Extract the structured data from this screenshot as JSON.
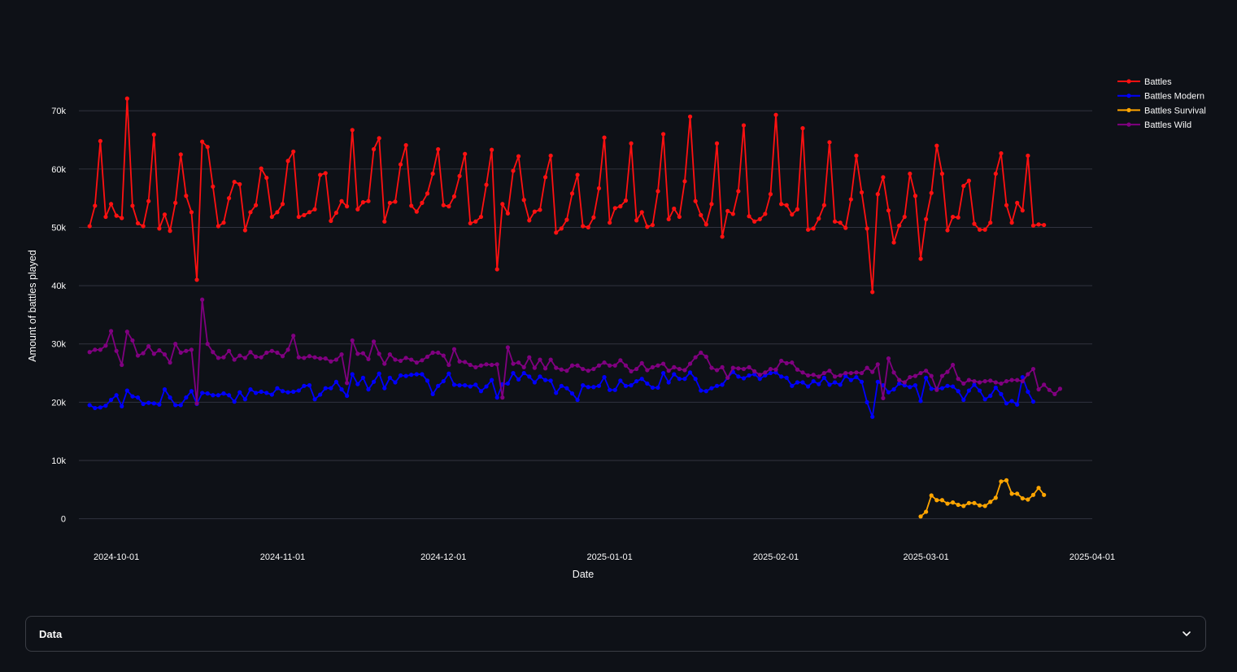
{
  "chart_data": {
    "type": "line",
    "xlabel": "Date",
    "ylabel": "Amount of battles played",
    "xlim": [
      "2024-09-24",
      "2025-04-01"
    ],
    "ylim": [
      -2000,
      77000
    ],
    "y_ticks": [
      0,
      10000,
      20000,
      30000,
      40000,
      50000,
      60000,
      70000
    ],
    "y_tick_labels": [
      "0",
      "10k",
      "20k",
      "30k",
      "40k",
      "50k",
      "60k",
      "70k"
    ],
    "x_ticks": [
      "2024-10-01",
      "2024-11-01",
      "2024-12-01",
      "2025-01-01",
      "2025-02-01",
      "2025-03-01",
      "2025-04-01"
    ],
    "grid": true,
    "legend": "top-right",
    "start_date": "2024-09-26",
    "series": [
      {
        "name": "Battles",
        "color": "#ff1111",
        "start": "2024-09-26",
        "values": [
          50200,
          53700,
          64800,
          51800,
          54000,
          52000,
          51600,
          72100,
          53700,
          50700,
          50200,
          54500,
          65900,
          49800,
          52200,
          49400,
          54200,
          62500,
          55400,
          52600,
          41000,
          64700,
          63800,
          57000,
          50200,
          50800,
          55000,
          57800,
          57400,
          49500,
          52600,
          53800,
          60100,
          58500,
          51800,
          52600,
          54000,
          61400,
          63000,
          51800,
          52100,
          52600,
          53100,
          59000,
          59300,
          51100,
          52500,
          54500,
          53600,
          66700,
          53100,
          54300,
          54500,
          63400,
          65300,
          51000,
          54200,
          54400,
          60800,
          64100,
          53700,
          52700,
          54200,
          55800,
          59200,
          63400,
          53800,
          53600,
          55300,
          58800,
          62600,
          50700,
          51000,
          51800,
          57300,
          63300,
          42800,
          54000,
          52400,
          59700,
          62200,
          54700,
          51200,
          52700,
          53000,
          58600,
          62300,
          49100,
          49800,
          51300,
          55800,
          59000,
          50200,
          50000,
          51700,
          56700,
          65400,
          50800,
          53300,
          53600,
          54600,
          64400,
          51200,
          52600,
          50100,
          50400,
          56200,
          66000,
          51400,
          53200,
          51800,
          57900,
          69000,
          54500,
          52100,
          50500,
          54000,
          64400,
          48400,
          52800,
          52300,
          56200,
          67500,
          51900,
          51000,
          51400,
          52300,
          55700,
          69300,
          54000,
          53800,
          52200,
          53100,
          67000,
          49600,
          49800,
          51500,
          53800,
          64600,
          51000,
          50800,
          49900,
          54800,
          62300,
          56000,
          49800,
          38900,
          55700,
          58600,
          52900,
          47400,
          50300,
          51800,
          59200,
          55400,
          44600,
          51400,
          55900,
          64000,
          59200,
          49500,
          51800,
          51700,
          57100,
          58000,
          50600,
          49600,
          49600,
          50800,
          59200,
          62700,
          53800,
          50800,
          54200,
          52900,
          62300,
          50300,
          50500,
          50400
        ]
      },
      {
        "name": "Battles Modern",
        "color": "#0000ff",
        "start": "2024-09-26",
        "values": [
          19500,
          19000,
          19100,
          19400,
          20400,
          21200,
          19300,
          22000,
          21000,
          20800,
          19700,
          19900,
          19800,
          19600,
          22200,
          20800,
          19500,
          19500,
          20800,
          21900,
          19700,
          21600,
          21500,
          21200,
          21200,
          21500,
          21200,
          20100,
          21700,
          20500,
          22200,
          21600,
          21800,
          21600,
          21300,
          22400,
          21900,
          21700,
          21800,
          22000,
          22800,
          22900,
          20500,
          21300,
          22400,
          22400,
          23500,
          22200,
          21100,
          24800,
          23100,
          24200,
          22200,
          23500,
          24900,
          22400,
          24200,
          23400,
          24600,
          24500,
          24700,
          24800,
          24800,
          23700,
          21400,
          22800,
          23600,
          24900,
          23000,
          22900,
          22900,
          22700,
          23000,
          21900,
          22700,
          23800,
          20800,
          23100,
          23200,
          25000,
          23900,
          25000,
          24400,
          23400,
          24400,
          23800,
          23700,
          21600,
          22800,
          22400,
          21500,
          20400,
          22900,
          22600,
          22600,
          22800,
          24300,
          22100,
          22100,
          23700,
          22800,
          22900,
          23600,
          24000,
          23200,
          22500,
          22500,
          25000,
          23400,
          24800,
          24000,
          24000,
          25100,
          24000,
          22000,
          21900,
          22400,
          22800,
          23000,
          24200,
          25200,
          24400,
          24100,
          24600,
          24800,
          24000,
          24600,
          25000,
          25100,
          24400,
          24200,
          22800,
          23400,
          23400,
          22700,
          23600,
          23100,
          24200,
          23000,
          23400,
          23000,
          24500,
          23800,
          24300,
          23500,
          20000,
          17500,
          23500,
          22900,
          21700,
          22200,
          23200,
          22900,
          22600,
          22900,
          20200,
          24200,
          22300,
          22300,
          22400,
          22800,
          22700,
          21900,
          20400,
          22000,
          23000,
          22000,
          20500,
          21100,
          22500,
          21400,
          19800,
          20200,
          19600,
          24300,
          21800,
          20100
        ]
      },
      {
        "name": "Battles Survival",
        "color": "#ffa500",
        "start": "2025-02-28",
        "values": [
          400,
          1200,
          4000,
          3200,
          3200,
          2600,
          2800,
          2400,
          2200,
          2700,
          2700,
          2300,
          2200,
          2900,
          3600,
          6400,
          6600,
          4300,
          4300,
          3500,
          3300,
          4100,
          5300,
          4100
        ]
      },
      {
        "name": "Battles Wild",
        "color": "#800080",
        "start": "2024-09-26",
        "values": [
          28600,
          29000,
          29000,
          29700,
          32200,
          28800,
          26400,
          32100,
          30600,
          28000,
          28400,
          29600,
          28300,
          28900,
          28200,
          26800,
          30000,
          28500,
          28800,
          29000,
          19800,
          37600,
          30000,
          28600,
          27600,
          27700,
          28800,
          27300,
          28000,
          27600,
          28600,
          27800,
          27700,
          28500,
          28800,
          28500,
          27900,
          29000,
          31400,
          27700,
          27600,
          27900,
          27700,
          27500,
          27500,
          27000,
          27300,
          28200,
          23300,
          30600,
          28300,
          28400,
          27400,
          30400,
          28300,
          26600,
          28200,
          27300,
          27100,
          27600,
          27300,
          26800,
          27200,
          27800,
          28500,
          28500,
          28000,
          26400,
          29100,
          27000,
          26900,
          26400,
          26000,
          26300,
          26500,
          26400,
          26500,
          20800,
          29400,
          26600,
          26800,
          26000,
          27700,
          25900,
          27300,
          25800,
          27300,
          25900,
          25600,
          25400,
          26300,
          26300,
          25700,
          25400,
          25700,
          26300,
          26800,
          26300,
          26300,
          27200,
          26300,
          25300,
          25700,
          26700,
          25500,
          26000,
          26300,
          26600,
          25400,
          26000,
          25700,
          25500,
          26600,
          27700,
          28500,
          27800,
          25900,
          25500,
          26000,
          24200,
          25900,
          25800,
          25700,
          26000,
          25300,
          24700,
          25100,
          25700,
          25600,
          27100,
          26700,
          26800,
          25600,
          25100,
          24600,
          24700,
          24400,
          25000,
          25400,
          24400,
          24600,
          25000,
          25000,
          25100,
          25000,
          25900,
          25200,
          26500,
          20700,
          27500,
          25100,
          23800,
          23400,
          24300,
          24500,
          25000,
          25400,
          24500,
          22100,
          24500,
          25200,
          26400,
          24000,
          23200,
          23800,
          23600,
          23400,
          23600,
          23700,
          23400,
          23200,
          23600,
          23800,
          23800,
          23600,
          24800,
          25700,
          22200,
          23000,
          22100,
          21400,
          22300
        ]
      }
    ]
  },
  "expander": {
    "label": "Data"
  }
}
